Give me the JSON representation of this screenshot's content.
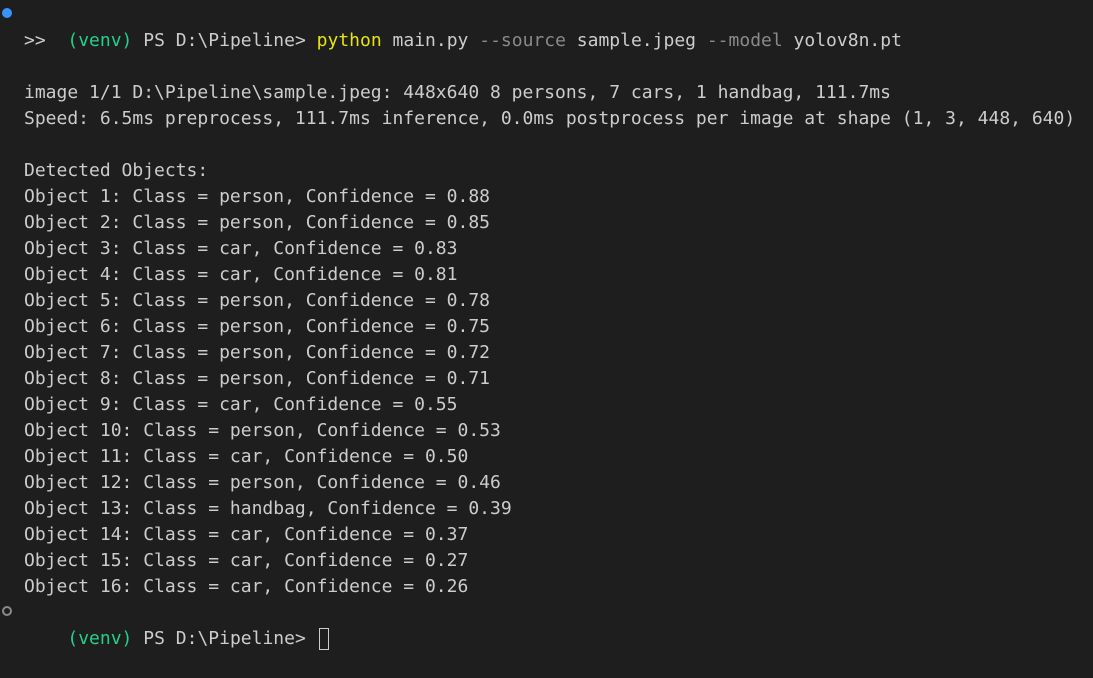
{
  "colors": {
    "background": "#1e1e1e",
    "text": "#cccccc",
    "venv": "#23d18b",
    "command": "#e5e510",
    "flag": "#8a8a8a",
    "marker_success": "#3794ff"
  },
  "prompt": {
    "venv": "(venv)",
    "ps": "PS",
    "path": "D:\\Pipeline>"
  },
  "command": {
    "program": "python",
    "script": "main.py",
    "flag1": "--source",
    "arg1": "sample.jpeg",
    "flag2": "--model",
    "arg2": "yolov8n.pt"
  },
  "continuation": ">>",
  "output": {
    "image_line": "image 1/1 D:\\Pipeline\\sample.jpeg: 448x640 8 persons, 7 cars, 1 handbag, 111.7ms",
    "speed_line": "Speed: 6.5ms preprocess, 111.7ms inference, 0.0ms postprocess per image at shape (1, 3, 448, 640)",
    "detected_header": "Detected Objects:",
    "objects": [
      "Object 1: Class = person, Confidence = 0.88",
      "Object 2: Class = person, Confidence = 0.85",
      "Object 3: Class = car, Confidence = 0.83",
      "Object 4: Class = car, Confidence = 0.81",
      "Object 5: Class = person, Confidence = 0.78",
      "Object 6: Class = person, Confidence = 0.75",
      "Object 7: Class = person, Confidence = 0.72",
      "Object 8: Class = person, Confidence = 0.71",
      "Object 9: Class = car, Confidence = 0.55",
      "Object 10: Class = person, Confidence = 0.53",
      "Object 11: Class = car, Confidence = 0.50",
      "Object 12: Class = person, Confidence = 0.46",
      "Object 13: Class = handbag, Confidence = 0.39",
      "Object 14: Class = car, Confidence = 0.37",
      "Object 15: Class = car, Confidence = 0.27",
      "Object 16: Class = car, Confidence = 0.26"
    ]
  }
}
